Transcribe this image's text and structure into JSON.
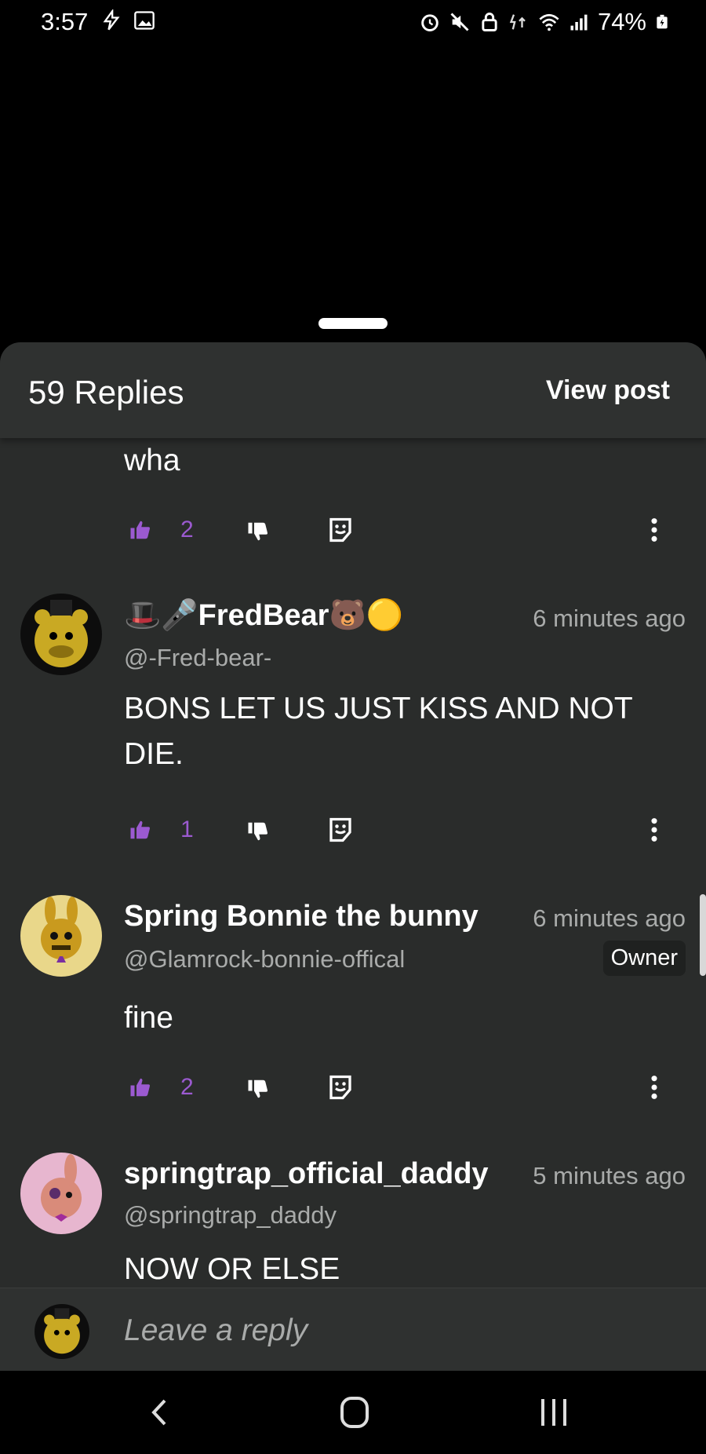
{
  "status_bar": {
    "time": "3:57",
    "battery": "74%",
    "left_icons": [
      "flash-icon",
      "image-icon"
    ],
    "right_icons": [
      "alarm-icon",
      "mute-icon",
      "lock-icon",
      "data-icon",
      "wifi-icon",
      "signal-icon",
      "battery-icon"
    ]
  },
  "header": {
    "replies_count": "59 Replies",
    "view_post": "View post"
  },
  "first_comment": {
    "text": "wha",
    "likes": "2"
  },
  "comments": [
    {
      "name": "🎩🎤FredBear🐻🟡",
      "handle": "@-Fred-bear-",
      "time": "6 minutes ago",
      "text": "BONS LET US JUST KISS AND NOT DIE.",
      "likes": "1"
    },
    {
      "name": "Spring Bonnie the bunny",
      "handle": "@Glamrock-bonnie-offical",
      "time": "6 minutes ago",
      "badge": "Owner",
      "text": "fine",
      "likes": "2"
    },
    {
      "name": "springtrap_official_daddy",
      "handle": "@springtrap_daddy",
      "time": "5 minutes ago",
      "text": "NOW OR ELSE"
    }
  ],
  "reply_bar": {
    "placeholder": "Leave a reply"
  },
  "colors": {
    "accent_purple": "#9b5ad0",
    "sheet_bg": "#2a2c2b",
    "header_bg": "#2f3130",
    "muted_text": "#a9abaa"
  }
}
